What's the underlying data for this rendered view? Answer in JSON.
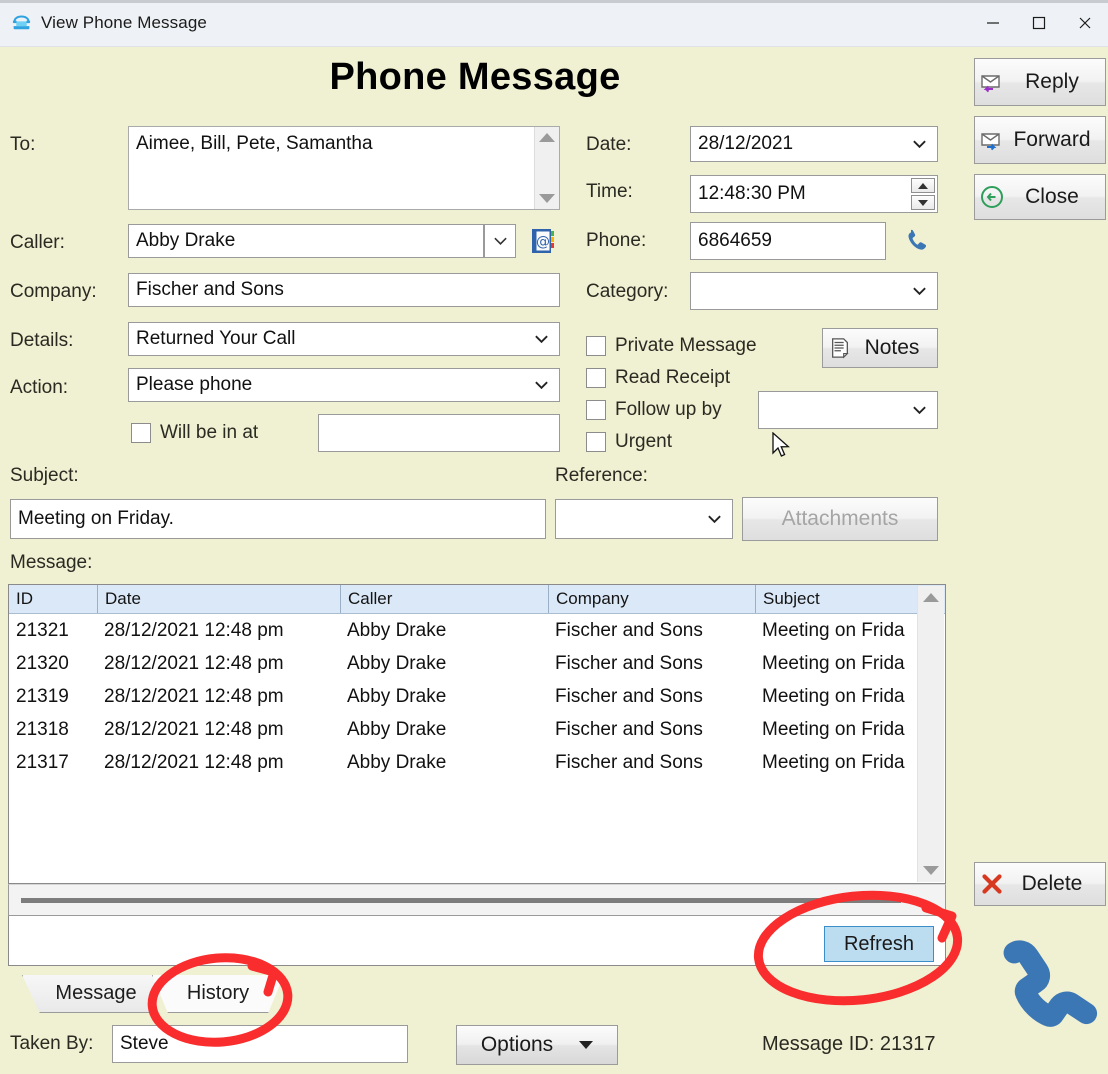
{
  "window": {
    "title": "View Phone Message",
    "icon": "telephone-icon",
    "minimize": "minimize-icon",
    "maximize": "maximize-icon",
    "close": "close-icon"
  },
  "header": {
    "title": "Phone Message"
  },
  "form": {
    "to_label": "To:",
    "to_value": "Aimee,  Bill,  Pete,  Samantha",
    "caller_label": "Caller:",
    "caller_value": "Abby Drake",
    "company_label": "Company:",
    "company_value": "Fischer and Sons",
    "details_label": "Details:",
    "details_value": "Returned Your Call",
    "action_label": "Action:",
    "action_value": "Please phone",
    "will_be_in_at_label": "Will be in at",
    "will_be_in_at_value": "",
    "date_label": "Date:",
    "date_value": "28/12/2021",
    "time_label": "Time:",
    "time_value": "12:48:30 PM",
    "phone_label": "Phone:",
    "phone_value": "6864659",
    "category_label": "Category:",
    "category_value": "",
    "private_message_label": "Private Message",
    "read_receipt_label": "Read Receipt",
    "follow_up_by_label": "Follow up by",
    "follow_up_by_value": "",
    "urgent_label": "Urgent",
    "notes_label": "Notes",
    "subject_label": "Subject:",
    "subject_value": "Meeting on Friday.",
    "reference_label": "Reference:",
    "reference_value": "",
    "attachments_label": "Attachments",
    "message_label": "Message:",
    "taken_by_label": "Taken By:",
    "taken_by_value": "Steve"
  },
  "history": {
    "columns": [
      "ID",
      "Date",
      "Caller",
      "Company",
      "Subject"
    ],
    "rows": [
      {
        "id": "21321",
        "date": "28/12/2021 12:48 pm",
        "caller": "Abby Drake",
        "company": "Fischer and Sons",
        "subject": "Meeting on Frida"
      },
      {
        "id": "21320",
        "date": "28/12/2021 12:48 pm",
        "caller": "Abby Drake",
        "company": "Fischer and Sons",
        "subject": "Meeting on Frida"
      },
      {
        "id": "21319",
        "date": "28/12/2021 12:48 pm",
        "caller": "Abby Drake",
        "company": "Fischer and Sons",
        "subject": "Meeting on Frida"
      },
      {
        "id": "21318",
        "date": "28/12/2021 12:48 pm",
        "caller": "Abby Drake",
        "company": "Fischer and Sons",
        "subject": "Meeting on Frida"
      },
      {
        "id": "21317",
        "date": "28/12/2021 12:48 pm",
        "caller": "Abby Drake",
        "company": "Fischer and Sons",
        "subject": "Meeting on Frida"
      }
    ],
    "refresh_label": "Refresh"
  },
  "tabs": [
    {
      "label": "Message",
      "selected": false
    },
    {
      "label": "History",
      "selected": true
    }
  ],
  "sidebar": {
    "reply_label": "Reply",
    "forward_label": "Forward",
    "close_label": "Close",
    "delete_label": "Delete"
  },
  "footer": {
    "options_label": "Options",
    "message_id": "Message ID: 21317"
  },
  "colors": {
    "window_background": "#f0f0d2",
    "titlebar": "#eef1f5",
    "grid_header": "#dbe8f7",
    "refresh_highlight": "#bcdcf0",
    "refresh_border": "#3a8fcb",
    "annotation": "#f92d2d",
    "phone_blue": "#3b77b5"
  }
}
